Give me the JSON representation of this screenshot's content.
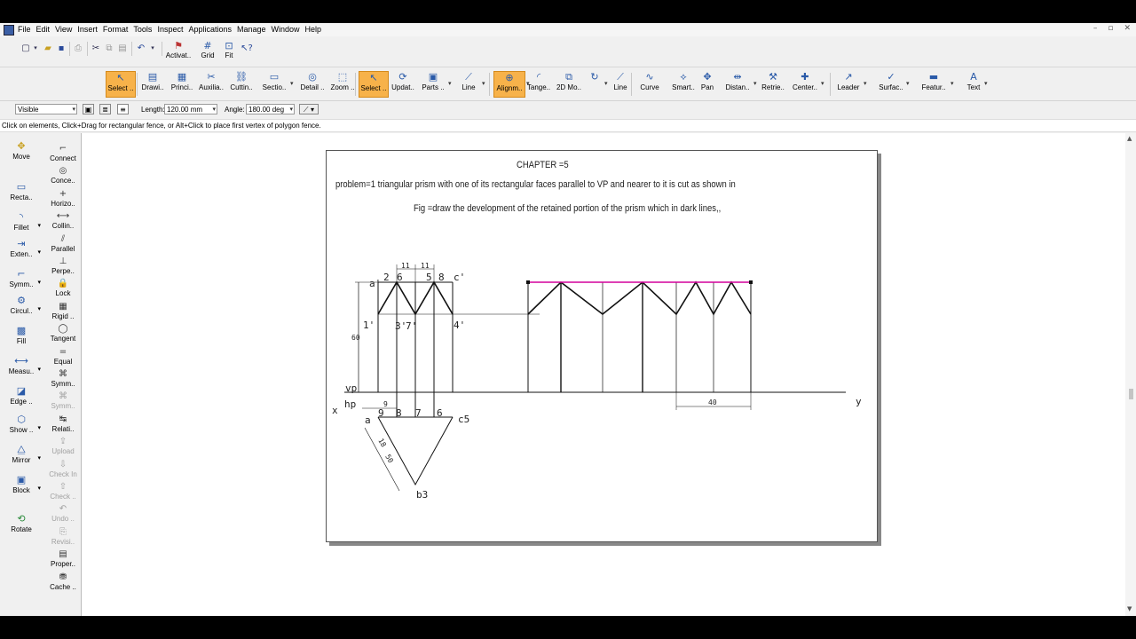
{
  "menus": [
    "File",
    "Edit",
    "View",
    "Insert",
    "Format",
    "Tools",
    "Inspect",
    "Applications",
    "Manage",
    "Window",
    "Help"
  ],
  "window_controls": [
    "–",
    "▫",
    "✕"
  ],
  "quick_bar": {
    "activate_label": "Activat..",
    "grid_label": "Grid",
    "fit_label": "Fit"
  },
  "ribbon": [
    {
      "label": "Select ..",
      "icon": "↖",
      "active": true
    },
    {
      "label": "Drawi..",
      "icon": "▤"
    },
    {
      "label": "Princi..",
      "icon": "▦"
    },
    {
      "label": "Auxilia..",
      "icon": "✂"
    },
    {
      "label": "Cuttin..",
      "icon": "⛓"
    },
    {
      "label": "Sectio..",
      "icon": "▭"
    },
    {
      "label": "Detail ..",
      "icon": "◎"
    },
    {
      "label": "Zoom ..",
      "icon": "⬚"
    },
    {
      "label": "Select ..",
      "icon": "↖",
      "active": true
    },
    {
      "label": "Updat..",
      "icon": "⟳"
    },
    {
      "label": "Parts ..",
      "icon": "▣"
    },
    {
      "label": "Line",
      "icon": "⟋"
    },
    {
      "label": "Alignm..",
      "icon": "⊕",
      "active": true
    },
    {
      "label": "Tange..",
      "icon": "◜"
    },
    {
      "label": "2D Mo..",
      "icon": "⧉"
    },
    {
      "label": "",
      "icon": "↻"
    },
    {
      "label": "Line",
      "icon": "⟋"
    },
    {
      "label": "Curve",
      "icon": "∿"
    },
    {
      "label": "Smart..",
      "icon": "⟡"
    },
    {
      "label": "Pan",
      "icon": "✥"
    },
    {
      "label": "Distan..",
      "icon": "⇹"
    },
    {
      "label": "Retrie..",
      "icon": "⚒"
    },
    {
      "label": "Center..",
      "icon": "✚"
    },
    {
      "label": "Leader",
      "icon": "↗"
    },
    {
      "label": "Surfac..",
      "icon": "✓"
    },
    {
      "label": "Featur..",
      "icon": "▬"
    },
    {
      "label": "Text",
      "icon": "A"
    }
  ],
  "props": {
    "linetype": "Visible",
    "length_label": "Length:",
    "length_value": "120.00 mm",
    "angle_label": "Angle:",
    "angle_value": "180.00 deg"
  },
  "prompt": "Click on elements, Click+Drag for rectangular fence, or Alt+Click to place first vertex of polygon fence.",
  "left_tools": [
    {
      "label": "Move",
      "icon": "✥"
    },
    {
      "label": "Recta..",
      "icon": "▭"
    },
    {
      "label": "Fillet",
      "icon": "◝"
    },
    {
      "label": "Exten..",
      "icon": "⇥"
    },
    {
      "label": "Symm..",
      "icon": "⌐"
    },
    {
      "label": "Circul..",
      "icon": "⚙"
    },
    {
      "label": "Fill",
      "icon": "▩"
    },
    {
      "label": "Measu..",
      "icon": "⟷"
    },
    {
      "label": "Edge ..",
      "icon": "◪"
    },
    {
      "label": "Show ..",
      "icon": "⬡"
    },
    {
      "label": "Mirror",
      "icon": "⧋"
    },
    {
      "label": "Block",
      "icon": "▣"
    },
    {
      "label": "Rotate",
      "icon": "⟲"
    }
  ],
  "constraint_tools": [
    {
      "label": "Connect",
      "icon": "⌐",
      "enabled": true
    },
    {
      "label": "Conce..",
      "icon": "◎",
      "enabled": true
    },
    {
      "label": "Horizo..",
      "icon": "+",
      "enabled": true
    },
    {
      "label": "Collin..",
      "icon": "⟷",
      "enabled": true
    },
    {
      "label": "Parallel",
      "icon": "⫽",
      "enabled": true
    },
    {
      "label": "Perpe..",
      "icon": "⊥",
      "enabled": true
    },
    {
      "label": "Lock",
      "icon": "🔒",
      "enabled": true
    },
    {
      "label": "Rigid ..",
      "icon": "▦",
      "enabled": true
    },
    {
      "label": "Tangent",
      "icon": "◯",
      "enabled": true
    },
    {
      "label": "Equal",
      "icon": "=",
      "enabled": true
    },
    {
      "label": "Symm..",
      "icon": "⌘",
      "enabled": true
    },
    {
      "label": "Symm..",
      "icon": "⌘",
      "enabled": false
    },
    {
      "label": "Relati..",
      "icon": "↹",
      "enabled": true
    },
    {
      "label": "Upload",
      "icon": "⇪",
      "enabled": false
    },
    {
      "label": "Check In",
      "icon": "⇩",
      "enabled": false
    },
    {
      "label": "Check ..",
      "icon": "⇧",
      "enabled": false
    },
    {
      "label": "Undo ..",
      "icon": "↶",
      "enabled": false
    },
    {
      "label": "Revisi..",
      "icon": "⎘",
      "enabled": false
    },
    {
      "label": "Proper..",
      "icon": "▤",
      "enabled": true
    },
    {
      "label": "Cache ..",
      "icon": "⛃",
      "enabled": true
    }
  ],
  "sheet": {
    "title": "CHAPTER  =5",
    "line1": "problem=1 triangular prism with one of its rectangular faces parallel to VP and nearer to it is cut as shown in",
    "line2": "Fig =draw the development of the retained portion of the prism which in dark lines,,"
  },
  "drawing_labels": {
    "a_prime": "a'",
    "n2": "2",
    "n6": "6",
    "n5": "5",
    "n8": "8",
    "c_prime": "c'",
    "dim11a": "11",
    "dim11b": "11",
    "one_prime": "1'",
    "three_prime": "3'",
    "seven_prime": "7'",
    "four_prime": "4'",
    "dim60": "60",
    "vp": "vp",
    "hp": "hp",
    "x": "x",
    "y": "y",
    "dim9": "9",
    "a": "a",
    "p9": "9",
    "p8": "8",
    "p7": "7",
    "p6": "6",
    "c5": "c5",
    "d18": "18",
    "d50": "50",
    "b3": "b3",
    "dim40": "40"
  },
  "colors": {
    "active_orange": "#f7b24a",
    "magenta_line": "#d4009b"
  }
}
